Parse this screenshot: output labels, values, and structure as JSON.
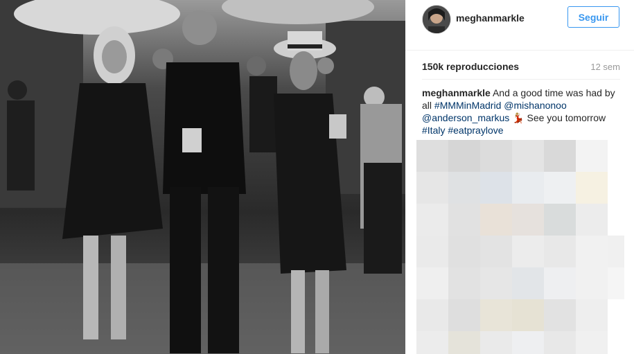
{
  "post": {
    "username": "meghanmarkle",
    "follow_label": "Seguir",
    "views": "150k reproducciones",
    "time_ago": "12 sem",
    "caption_user": "meghanmarkle",
    "caption_text_1": " And a good time was had by all ",
    "hashtag_1": "#MMMinMadrid",
    "mention_1": "@mishanonoo",
    "mention_2": "@anderson_markus",
    "caption_text_2": " 💃🏼 See you tomorrow ",
    "hashtag_2": "#Italy",
    "hashtag_3": "#eatpraylove"
  },
  "colors": {
    "accent": "#3897f0",
    "link": "#003569",
    "text": "#262626",
    "muted": "#999999"
  },
  "icons": {
    "avatar": "profile-photo",
    "media": "video-frame"
  }
}
